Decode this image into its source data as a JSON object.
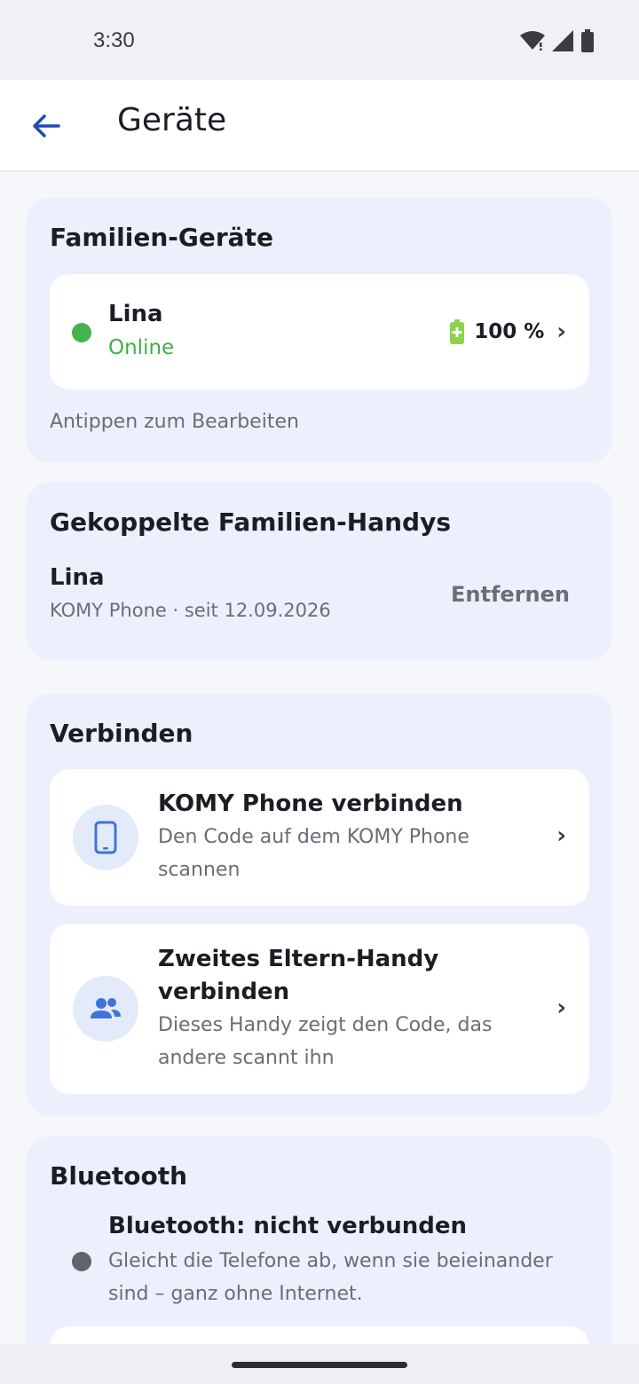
{
  "status_bar": {
    "time": "3:30"
  },
  "app_bar": {
    "title": "Geräte"
  },
  "family_devices": {
    "title": "Familien-Geräte",
    "device": {
      "name": "Lina",
      "status": "Online",
      "battery": "100 %"
    },
    "hint": "Antippen zum Bearbeiten"
  },
  "paired": {
    "title": "Gekoppelte Familien-Handys",
    "name": "Lina",
    "detail": "KOMY Phone · seit 12.09.2026",
    "remove_label": "Entfernen"
  },
  "connect": {
    "title": "Verbinden",
    "options": [
      {
        "title": "KOMY Phone verbinden",
        "subtitle": "Den Code auf dem KOMY Phone scannen",
        "icon": "phone-icon"
      },
      {
        "title": "Zweites Eltern-Handy verbinden",
        "subtitle": "Dieses Handy zeigt den Code, das andere scannt ihn",
        "icon": "people-icon"
      }
    ]
  },
  "bluetooth": {
    "title": "Bluetooth",
    "status": "Bluetooth: nicht verbunden",
    "description": "Gleicht die Telefone ab, wenn sie beieinander sind – ganz ohne Internet."
  },
  "colors": {
    "accent": "#1f4bb5",
    "online": "#43b34d",
    "card_bg": "#ebf0fc"
  }
}
